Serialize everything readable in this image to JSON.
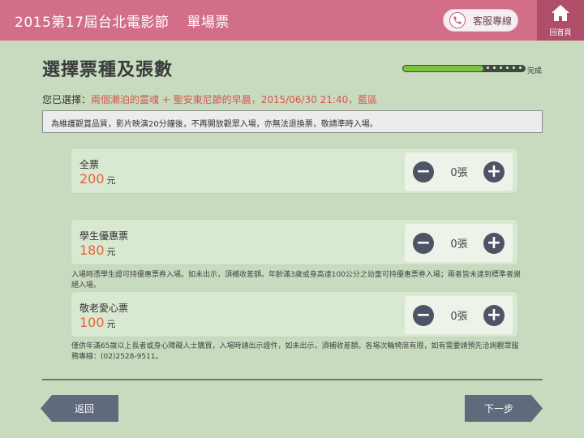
{
  "header": {
    "title": "2015第17屆台北電影節",
    "subtitle": "單場票",
    "service_label": "客服專線",
    "home_label": "回首頁"
  },
  "page": {
    "title": "選擇票種及張數",
    "progress_label": "完成",
    "progress_fraction": 0.66
  },
  "selection": {
    "label": "您已選擇：",
    "value": "兩個瀨泊的靈魂 + 聖安東尼節的早晨，2015/06/30 21:40，藍區"
  },
  "notice": "為維護觀賞品質，影片映演20分鐘後，不再開放觀眾入場，亦無法退換票，敬請準時入場。",
  "tickets": [
    {
      "name": "全票",
      "price": "200",
      "unit": "元",
      "qty": "0張"
    },
    {
      "name": "學生優惠票",
      "price": "180",
      "unit": "元",
      "qty": "0張"
    },
    {
      "name": "敬老愛心票",
      "price": "100",
      "unit": "元",
      "qty": "0張"
    }
  ],
  "notes": {
    "student": "入場時憑學生證可持優惠票券入場。如未出示，須補收差額。年齡滿3歲或身高達100公分之幼童可持優惠票券入場；兩者皆未達到標準者謝絕入場。",
    "senior": "僅供年滿65歲以上長者或身心障礙人士購買，入場時請出示證件，如未出示，須補收差額。各場次輪椅席有限，如有需要請預先洽詢觀眾服務專線：(02)2528-9511。"
  },
  "buttons": {
    "back": "返回",
    "next": "下一步"
  },
  "colors": {
    "header": "#d36e88",
    "background": "#c8dbbf",
    "price": "#e8643a",
    "selection_value": "#d9534f",
    "progress_fill": "#7cc241"
  }
}
